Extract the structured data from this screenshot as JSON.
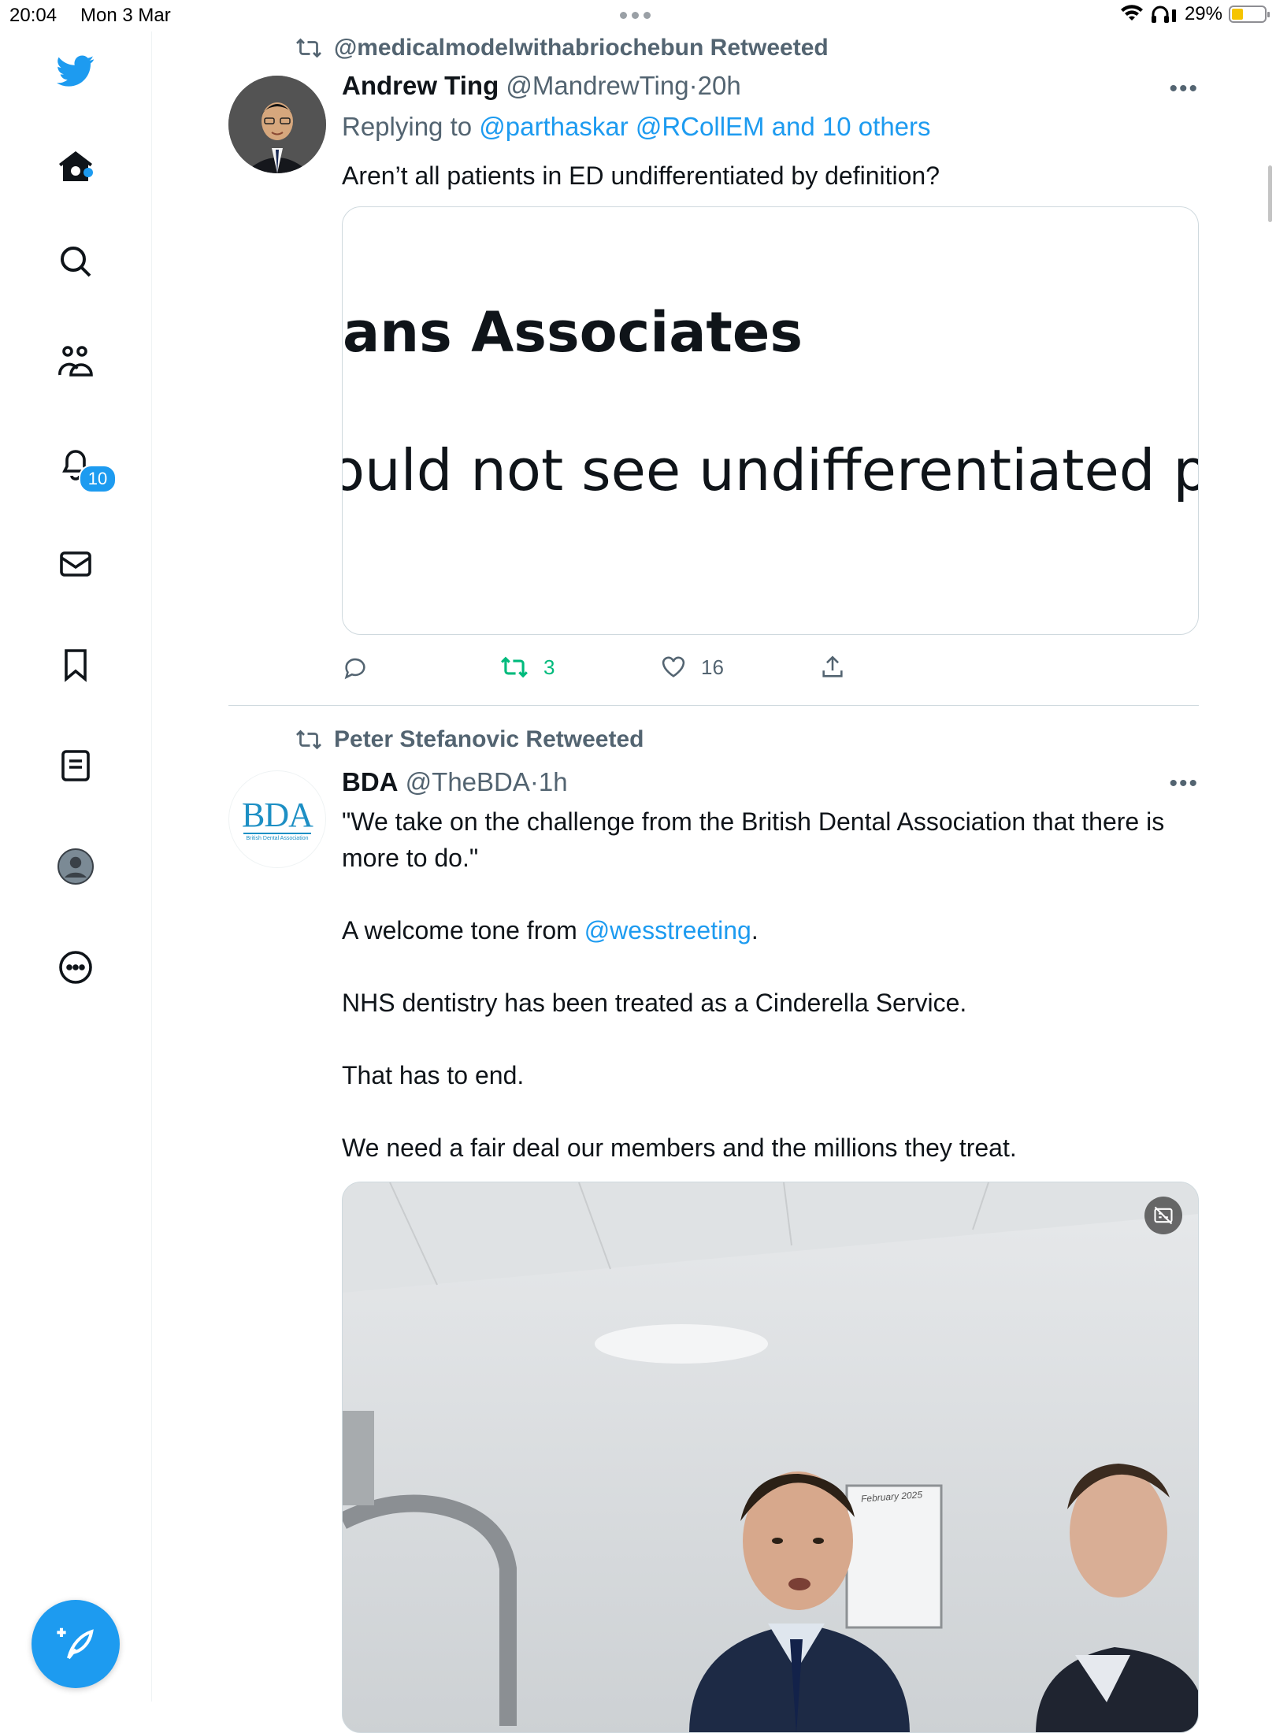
{
  "status_bar": {
    "time": "20:04",
    "date": "Mon 3 Mar",
    "battery_text": "29%"
  },
  "sidebar": {
    "notifications_badge": "10",
    "items": [
      {
        "icon": "twitter-logo-icon"
      },
      {
        "icon": "home-icon"
      },
      {
        "icon": "search-icon"
      },
      {
        "icon": "communities-icon"
      },
      {
        "icon": "notifications-icon"
      },
      {
        "icon": "messages-icon"
      },
      {
        "icon": "bookmarks-icon"
      },
      {
        "icon": "lists-icon"
      },
      {
        "icon": "profile-icon"
      },
      {
        "icon": "more-icon"
      }
    ],
    "compose_icon": "compose-tweet-icon"
  },
  "tweets": [
    {
      "retweeted_by": "@medicalmodelwithabriochebun Retweeted",
      "name": "Andrew Ting",
      "handle": "@MandrewTing",
      "sep": "·",
      "time": "20h",
      "reply_prefix": "Replying to ",
      "reply_to": "@parthaskar @RCollEM and 10 others",
      "text": "Aren’t all patients in ED undifferentiated by definition?",
      "media_lines": [
        "ans Associates",
        "ould not see undifferentiated pati"
      ],
      "reply_count": "",
      "retweet_count": "3",
      "like_count": "16"
    },
    {
      "retweeted_by": "Peter Stefanovic Retweeted",
      "name": "BDA",
      "handle": "@TheBDA",
      "sep": "·",
      "time": "1h",
      "avatar_logo": "BDA",
      "avatar_subtitle": "British Dental Association",
      "paragraphs": [
        "\"We take on the challenge from the British Dental Association that there is more to do.\"",
        "A welcome tone from ",
        "NHS dentistry has been treated as a Cinderella Service.",
        "That has to end.",
        "We need a fair deal our members and the millions they treat."
      ],
      "mention": "@wesstreeting",
      "after_mention": ".",
      "video_whiteboard": "February 2025"
    }
  ],
  "colors": {
    "accent": "#1d9bf0",
    "secondary_text": "#536471",
    "retweet_green": "#00ba7c"
  }
}
